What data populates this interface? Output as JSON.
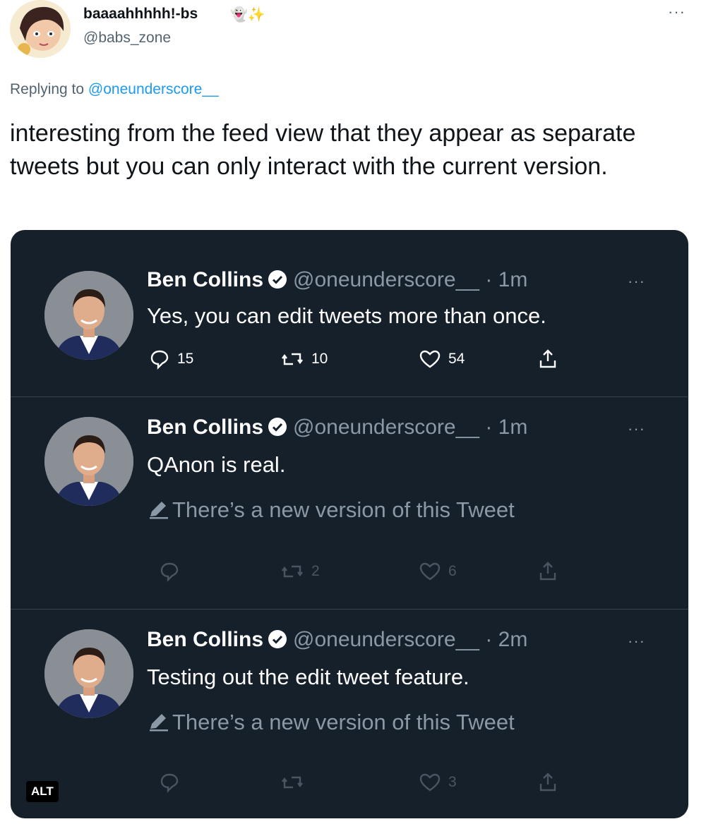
{
  "reply_tweet": {
    "display_name": "baaaahhhhh!-bs",
    "name_emojis": "👻✨",
    "handle": "@babs_zone",
    "more_label": "···",
    "replying_prefix": "Replying to ",
    "replying_to": "@oneunderscore__",
    "text": "interesting from the feed view that they appear as separate tweets but you can only interact with the current version."
  },
  "embedded_tweets": [
    {
      "name": "Ben Collins",
      "handle": "@oneunderscore__",
      "time": "· 1m",
      "text": "Yes, you can edit tweets more than once.",
      "edit_note": "",
      "replies": "15",
      "retweets": "10",
      "likes": "54"
    },
    {
      "name": "Ben Collins",
      "handle": "@oneunderscore__",
      "time": "· 1m",
      "text": "QAnon is real.",
      "edit_note": "There’s a new version of this Tweet",
      "replies": "",
      "retweets": "2",
      "likes": "6"
    },
    {
      "name": "Ben Collins",
      "handle": "@oneunderscore__",
      "time": "· 2m",
      "text": "Testing out the edit tweet feature.",
      "edit_note": "There’s a new version of this Tweet",
      "replies": "",
      "retweets": "",
      "likes": "3"
    }
  ],
  "alt_badge": "ALT",
  "colors": {
    "card_bg": "#15202b",
    "accent": "#1d9bf0",
    "muted_dark": "#8b98a5",
    "disabled_action": "#4a5561"
  }
}
